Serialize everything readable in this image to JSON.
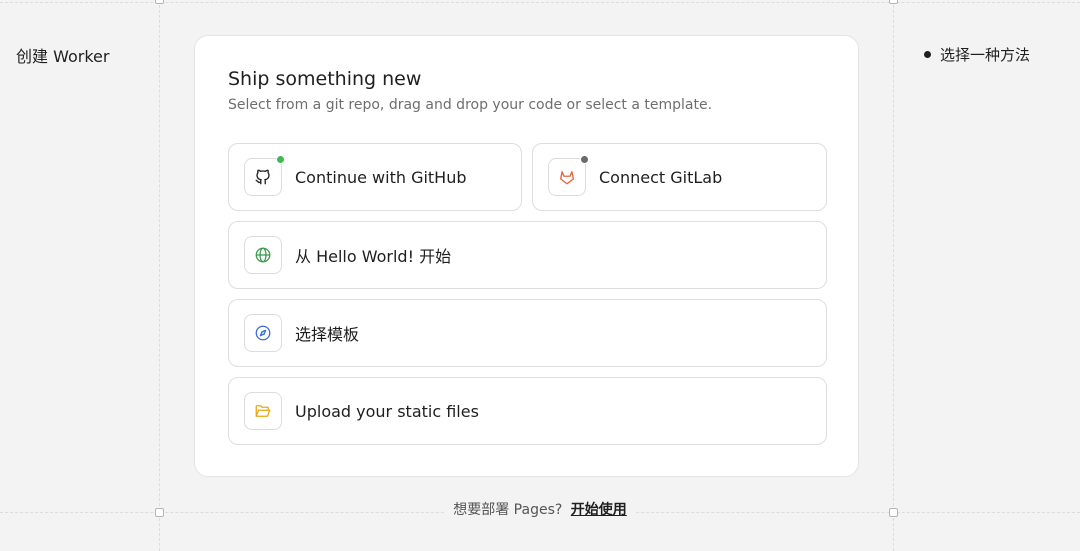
{
  "page": {
    "title": "创建 Worker"
  },
  "steps": [
    {
      "label": "选择一种方法"
    }
  ],
  "card": {
    "title": "Ship something new",
    "subtitle": "Select from a git repo, drag and drop your code or select a template."
  },
  "options": {
    "github": {
      "label": "Continue with GitHub",
      "icon": "github-icon",
      "status_color": "#3fb950"
    },
    "gitlab": {
      "label": "Connect GitLab",
      "icon": "gitlab-icon",
      "status_color": "#6b6b6b"
    },
    "hello_world": {
      "label": "从 Hello World! 开始",
      "icon": "globe-icon"
    },
    "template": {
      "label": "选择模板",
      "icon": "compass-icon"
    },
    "upload": {
      "label": "Upload your static files",
      "icon": "folder-open-icon"
    }
  },
  "footer": {
    "prompt": "想要部署 Pages?",
    "link": "开始使用"
  },
  "colors": {
    "github_status": "#3fb950",
    "gitlab_status": "#6b6b6b",
    "gitlab_orange": "#e8643c",
    "globe_green": "#3c9a4c",
    "compass_blue": "#3b6fd8",
    "folder_yellow": "#e5a912"
  }
}
